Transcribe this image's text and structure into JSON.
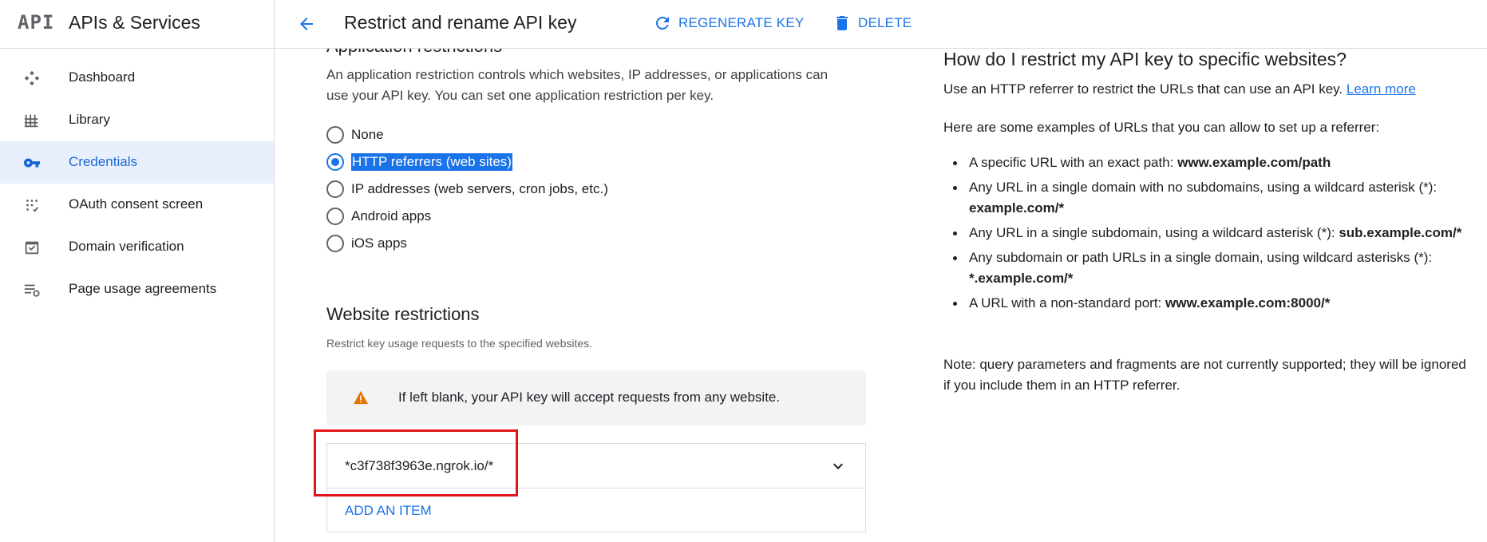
{
  "header": {
    "logo_text": "API",
    "app_title": "APIs & Services",
    "page_title": "Restrict and rename API key",
    "regenerate_label": "REGENERATE KEY",
    "delete_label": "DELETE"
  },
  "sidebar": {
    "items": [
      {
        "label": "Dashboard",
        "icon": "dashboard-icon",
        "active": false
      },
      {
        "label": "Library",
        "icon": "library-icon",
        "active": false
      },
      {
        "label": "Credentials",
        "icon": "key-icon",
        "active": true
      },
      {
        "label": "OAuth consent screen",
        "icon": "oauth-consent-icon",
        "active": false
      },
      {
        "label": "Domain verification",
        "icon": "domain-verification-icon",
        "active": false
      },
      {
        "label": "Page usage agreements",
        "icon": "page-usage-icon",
        "active": false
      }
    ]
  },
  "app_restrictions": {
    "heading": "Application restrictions",
    "description": "An application restriction controls which websites, IP addresses, or applications can use your API key. You can set one application restriction per key.",
    "options": [
      {
        "label": "None",
        "checked": false
      },
      {
        "label": "HTTP referrers (web sites)",
        "checked": true
      },
      {
        "label": "IP addresses (web servers, cron jobs, etc.)",
        "checked": false
      },
      {
        "label": "Android apps",
        "checked": false
      },
      {
        "label": "iOS apps",
        "checked": false
      }
    ]
  },
  "website_restrictions": {
    "heading": "Website restrictions",
    "subtitle": "Restrict key usage requests to the specified websites.",
    "warning": "If left blank, your API key will accept requests from any website.",
    "item_value": "*c3f738f3963e.ngrok.io/*",
    "add_item_label": "ADD AN ITEM"
  },
  "help": {
    "title": "How do I restrict my API key to specific websites?",
    "intro": "Use an HTTP referrer to restrict the URLs that can use an API key.",
    "learn_more": "Learn more",
    "examples_intro": "Here are some examples of URLs that you can allow to set up a referrer:",
    "examples": [
      {
        "text": "A specific URL with an exact path: ",
        "example": "www.example.com/path"
      },
      {
        "text": "Any URL in a single domain with no subdomains, using a wildcard asterisk (*): ",
        "example": "example.com/*"
      },
      {
        "text": "Any URL in a single subdomain, using a wildcard asterisk (*): ",
        "example": "sub.example.com/*"
      },
      {
        "text": "Any subdomain or path URLs in a single domain, using wildcard asterisks (*): ",
        "example": "*.example.com/*"
      },
      {
        "text": "A URL with a non-standard port: ",
        "example": "www.example.com:8000/*"
      }
    ],
    "note": "Note: query parameters and fragments are not currently supported; they will be ignored if you include them in an HTTP referrer."
  },
  "colors": {
    "accent": "#1a73e8",
    "active_nav_bg": "#e8f0fe",
    "warning": "#e37400",
    "annotation_red": "#e3141c"
  }
}
